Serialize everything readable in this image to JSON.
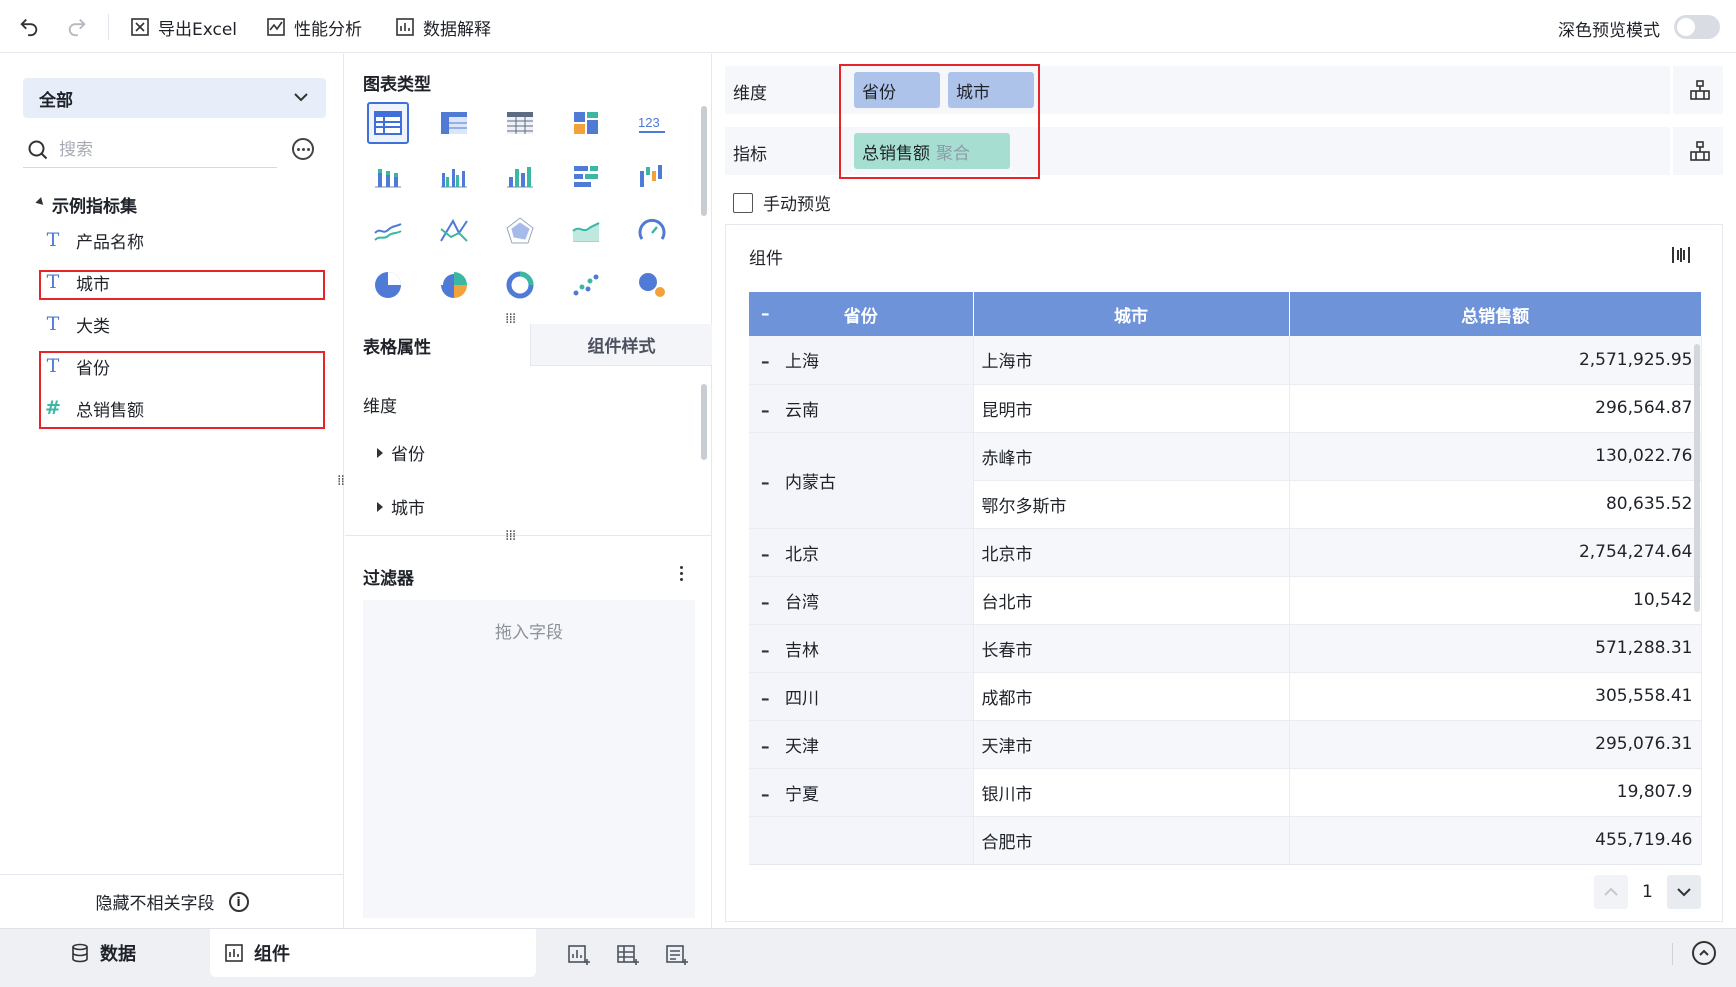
{
  "toolbar": {
    "export_excel": "导出Excel",
    "perf_analysis": "性能分析",
    "data_explain": "数据解释",
    "dark_preview": "深色预览模式"
  },
  "left": {
    "scope": "全部",
    "search_placeholder": "搜索",
    "group": "示例指标集",
    "fields": [
      {
        "name": "产品名称",
        "type": "text"
      },
      {
        "name": "城市",
        "type": "text"
      },
      {
        "name": "大类",
        "type": "text"
      },
      {
        "name": "省份",
        "type": "text"
      },
      {
        "name": "总销售额",
        "type": "number"
      }
    ],
    "hide_irrelevant": "隐藏不相关字段"
  },
  "middle": {
    "chart_type_title": "图表类型",
    "tab_table_props": "表格属性",
    "tab_component_style": "组件样式",
    "dimension_label": "维度",
    "dimension_items": [
      "省份",
      "城市"
    ],
    "filter_title": "过滤器",
    "drop_hint": "拖入字段"
  },
  "right": {
    "dimension_label": "维度",
    "measure_label": "指标",
    "dimension_pills": [
      "省份",
      "城市"
    ],
    "measure_pill": "总销售额",
    "measure_agg": "聚合",
    "manual_preview": "手动预览",
    "widget_title": "组件",
    "table": {
      "headers": [
        "省份",
        "城市",
        "总销售额"
      ],
      "rows": [
        {
          "province": "上海",
          "city": "上海市",
          "sales": "2,571,925.95"
        },
        {
          "province": "云南",
          "city": "昆明市",
          "sales": "296,564.87"
        },
        {
          "province": "内蒙古",
          "city": "赤峰市",
          "sales": "130,022.76"
        },
        {
          "province": "",
          "city": "鄂尔多斯市",
          "sales": "80,635.52"
        },
        {
          "province": "北京",
          "city": "北京市",
          "sales": "2,754,274.64"
        },
        {
          "province": "台湾",
          "city": "台北市",
          "sales": "10,542"
        },
        {
          "province": "吉林",
          "city": "长春市",
          "sales": "571,288.31"
        },
        {
          "province": "四川",
          "city": "成都市",
          "sales": "305,558.41"
        },
        {
          "province": "天津",
          "city": "天津市",
          "sales": "295,076.31"
        },
        {
          "province": "宁夏",
          "city": "银川市",
          "sales": "19,807.9"
        },
        {
          "province": "",
          "city": "合肥市",
          "sales": "455,719.46"
        }
      ]
    },
    "page": "1"
  },
  "bottom": {
    "tab_data": "数据",
    "tab_component": "组件"
  },
  "colors": {
    "accent": "#3f6fd8",
    "header_bg": "#6f93d8",
    "dim_pill": "#aec3ea",
    "measure_pill": "#a6dfd2",
    "highlight_red": "#e5252a"
  }
}
